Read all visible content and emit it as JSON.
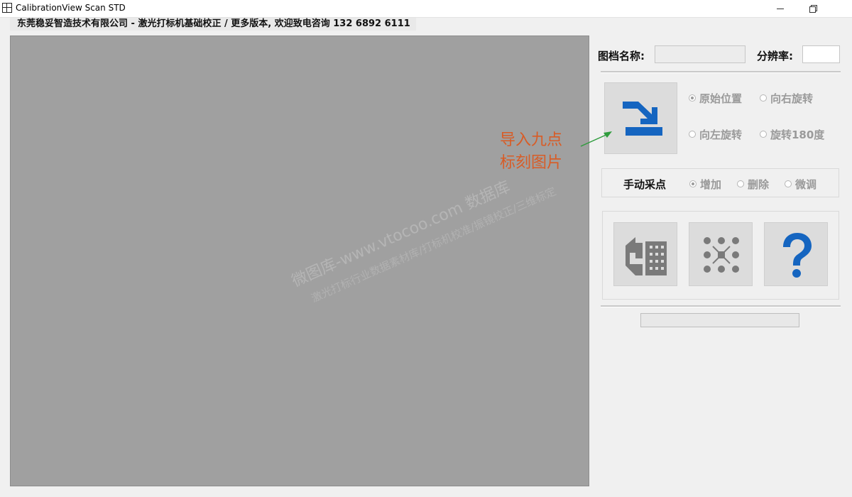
{
  "window": {
    "title": "CalibrationView Scan STD"
  },
  "header": {
    "company_line": "东莞稳妥智造技术有限公司 - 激光打标机基础校正  /  更多版本, 欢迎致电咨询 132 6892 6111"
  },
  "watermark": {
    "line1": "微图库-www.vtocoo.com 数据库",
    "line2": "激光打标行业数据素材库/打标机校准/振镜校正/三维标定"
  },
  "panel": {
    "image_name_label": "图档名称:",
    "image_name_value": "",
    "resolution_label": "分辨率:",
    "resolution_value": "",
    "orientation_options": [
      {
        "label": "原始位置",
        "checked": true
      },
      {
        "label": "向右旋转",
        "checked": false
      },
      {
        "label": "向左旋转",
        "checked": false
      },
      {
        "label": "旋转180度",
        "checked": false
      }
    ],
    "manual_sampling_label": "手动采点",
    "manual_options": [
      {
        "label": "增加",
        "checked": true
      },
      {
        "label": "删除",
        "checked": false
      },
      {
        "label": "微调",
        "checked": false
      }
    ],
    "progress": 0
  },
  "annotation": {
    "line1": "导入九点",
    "line2": "标刻图片",
    "color": "#d85c26"
  },
  "icons": {
    "import": "import-arrow-icon",
    "export": "export-to-building-icon",
    "nine_point": "nine-point-grid-icon",
    "help": "question-mark-icon"
  },
  "colors": {
    "canvas": "#a0a0a0",
    "icon_blue": "#1565c0",
    "icon_gray": "#7a7a7a"
  }
}
